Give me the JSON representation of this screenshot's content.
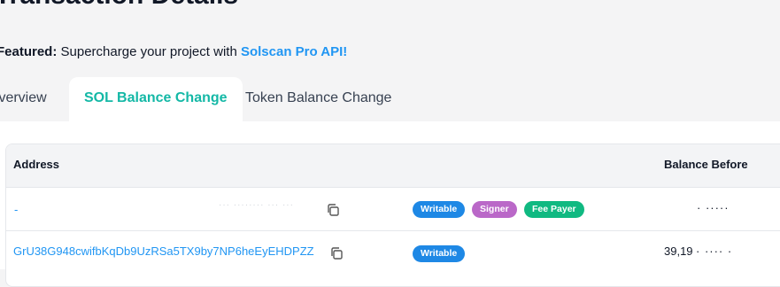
{
  "page": {
    "title": "Transaction Details"
  },
  "featured": {
    "label": "Featured:",
    "text": "Supercharge your project with",
    "link": "Solscan Pro API!"
  },
  "tabs": [
    {
      "label": "Overview"
    },
    {
      "label": "SOL Balance Change",
      "active": true
    },
    {
      "label": "Token Balance Change"
    }
  ],
  "table": {
    "columns": {
      "address": "Address",
      "balance_before": "Balance Before"
    },
    "rows": [
      {
        "address": "-",
        "address_faded": "··· ········ ··· ···",
        "badges": [
          "Writable",
          "Signer",
          "Fee Payer"
        ],
        "balance_before": "· ·····"
      },
      {
        "address": "GrU38G948cwifbKqDb9UzRSa5TX9by7NP6heEyEHDPZZ",
        "badges": [
          "Writable"
        ],
        "balance_before": "39,19",
        "balance_faded": "· ····  ·"
      }
    ]
  },
  "colors": {
    "accent_tab": "#14b8a6",
    "link": "#2196f3",
    "writable": "#1e88e5",
    "signer": "#ba68c8",
    "fee_payer": "#10b981"
  }
}
